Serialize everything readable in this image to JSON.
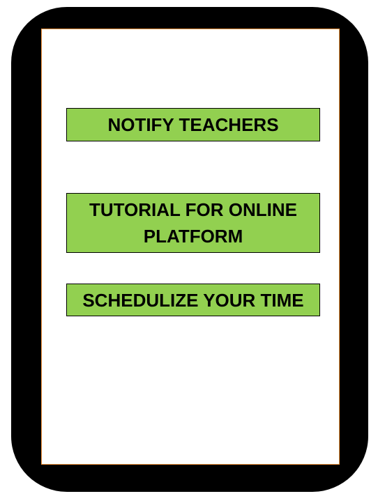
{
  "colors": {
    "frame": "#000000",
    "screen_border": "#f0913a",
    "button_fill": "#92d050"
  },
  "buttons": [
    {
      "label": "NOTIFY TEACHERS"
    },
    {
      "label": "TUTORIAL FOR ONLINE PLATFORM"
    },
    {
      "label": "SCHEDULIZE YOUR TIME"
    }
  ]
}
